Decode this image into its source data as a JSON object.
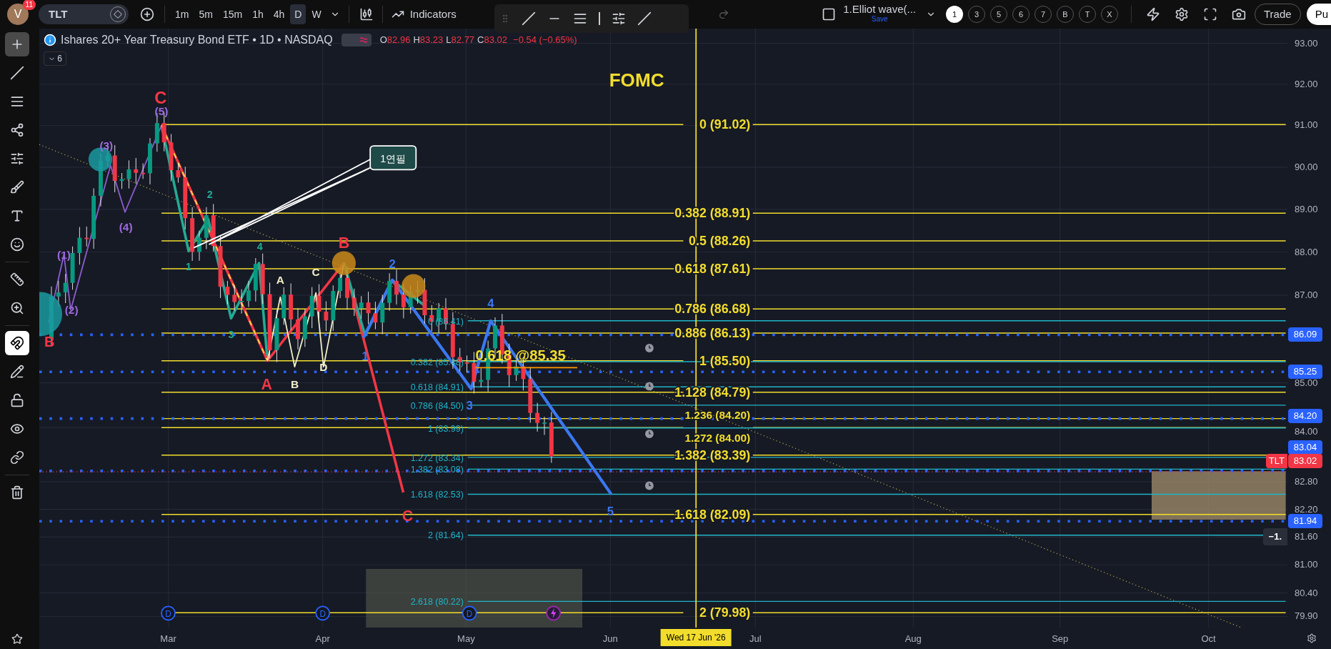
{
  "top_bar": {
    "avatar": "V",
    "badge": "11",
    "symbol": "TLT",
    "intervals": [
      {
        "label": "1m",
        "selected": false
      },
      {
        "label": "5m",
        "selected": false
      },
      {
        "label": "15m",
        "selected": false
      },
      {
        "label": "1h",
        "selected": false
      },
      {
        "label": "4h",
        "selected": false
      },
      {
        "label": "D",
        "selected": true
      },
      {
        "label": "W",
        "selected": false
      }
    ],
    "indicators": "Indicators",
    "layout": {
      "name": "1.Elliot wave(...",
      "save": "Save"
    },
    "hotkeys": [
      {
        "label": "1",
        "selected": true
      },
      {
        "label": "3",
        "selected": false
      },
      {
        "label": "5",
        "selected": false
      },
      {
        "label": "6",
        "selected": false
      },
      {
        "label": "7",
        "selected": false
      },
      {
        "label": "B",
        "selected": false
      },
      {
        "label": "T",
        "selected": false
      },
      {
        "label": "X",
        "selected": false
      }
    ],
    "trade": "Trade",
    "publish": "Pu"
  },
  "left_toolbar": [
    {
      "kind": "crosshair",
      "selected": true,
      "active": false
    },
    {
      "kind": "trendline",
      "selected": false,
      "active": false
    },
    {
      "kind": "fib",
      "selected": false,
      "active": false
    },
    {
      "kind": "pattern",
      "selected": false,
      "active": false
    },
    {
      "kind": "forecast",
      "selected": false,
      "active": false
    },
    {
      "kind": "brush",
      "selected": false,
      "active": false
    },
    {
      "kind": "text",
      "selected": false,
      "active": false
    },
    {
      "kind": "emoji",
      "selected": false,
      "active": false
    },
    {
      "kind": "ruler",
      "selected": false,
      "active": false
    },
    {
      "kind": "zoom",
      "selected": false,
      "active": false
    },
    {
      "kind": "magnet",
      "selected": false,
      "active": true
    },
    {
      "kind": "lockdraw",
      "selected": false,
      "active": false
    },
    {
      "kind": "lock",
      "selected": false,
      "active": false
    },
    {
      "kind": "eye",
      "selected": false,
      "active": false
    },
    {
      "kind": "link",
      "selected": false,
      "active": false
    },
    {
      "kind": "trash",
      "selected": false,
      "active": false
    }
  ],
  "legend": {
    "title": "Ishares 20+ Year Treasury Bond ETF • 1D • NASDAQ",
    "ohlc": [
      {
        "key": "O",
        "value": "82.96"
      },
      {
        "key": "H",
        "value": "83.23"
      },
      {
        "key": "L",
        "value": "82.77"
      },
      {
        "key": "C",
        "value": "83.02"
      }
    ],
    "change": "−0.54 (−0.65%)",
    "collapse": "6"
  },
  "chart": {
    "event_title": "FOMC",
    "target_label": "0.618 @85.35",
    "callout": "1연필",
    "wave_labels": [
      {
        "text": "C",
        "color": "#f23645"
      },
      {
        "text": "(5)",
        "color": "#9c6ade"
      },
      {
        "text": "(3)",
        "color": "#9c6ade"
      },
      {
        "text": "(4)",
        "color": "#9c6ade"
      },
      {
        "text": "(1)",
        "color": "#9c6ade"
      },
      {
        "text": "(2)",
        "color": "#9c6ade"
      },
      {
        "text": "B",
        "color": "#f23645"
      },
      {
        "text": "1",
        "color": "#22ab94"
      },
      {
        "text": "2",
        "color": "#22ab94"
      },
      {
        "text": "3",
        "color": "#22ab94"
      },
      {
        "text": "4",
        "color": "#22ab94"
      },
      {
        "text": "A",
        "color": "#f3f0c8"
      },
      {
        "text": "C",
        "color": "#f3f0c8"
      },
      {
        "text": "B",
        "color": "#f3f0c8"
      },
      {
        "text": "D",
        "color": "#f3f0c8"
      },
      {
        "text": "A",
        "color": "#f23645"
      },
      {
        "text": "B",
        "color": "#f23645"
      },
      {
        "text": "1",
        "color": "#3b78f0"
      },
      {
        "text": "2",
        "color": "#3b78f0"
      },
      {
        "text": "3",
        "color": "#3b78f0"
      },
      {
        "text": "4",
        "color": "#3b78f0"
      },
      {
        "text": "5",
        "color": "#3b78f0"
      },
      {
        "text": "C",
        "color": "#f23645"
      }
    ],
    "fib_right": [
      "0 (91.02)",
      "0.382 (88.91)",
      "0.5 (88.26)",
      "0.618 (87.61)",
      "0.786 (86.68)",
      "0.886 (86.13)",
      "1 (85.50)",
      "1.128 (84.79)",
      "1.236 (84.20)",
      "1.272 (84.00)",
      "1.382 (83.39)",
      "1.618 (82.09)",
      "2 (79.98)"
    ],
    "fib_left": [
      "0 (86.41)",
      "0.382 (85.48)",
      "0.618 (84.91)",
      "0.786 (84.50)",
      "1 (83.99)",
      "1.272 (83.34)",
      "1.382 (83.08)",
      "1.618 (82.53)",
      "2 (81.64)",
      "2.618 (80.22)"
    ],
    "events": [
      {
        "kind": "dividend",
        "label": "D"
      },
      {
        "kind": "dividend",
        "label": "D"
      },
      {
        "kind": "dividend",
        "label": "D"
      },
      {
        "kind": "earnings"
      }
    ],
    "tooltip": "−1."
  },
  "price_axis": {
    "labels": [
      "93.00",
      "92.00",
      "91.00",
      "90.00",
      "89.00",
      "88.00",
      "87.00",
      "85.00",
      "84.00",
      "82.80",
      "82.20",
      "81.60",
      "81.00",
      "80.40",
      "79.90"
    ],
    "badges": [
      {
        "text": "86.09",
        "color": "#2962ff"
      },
      {
        "text": "85.25",
        "color": "#2962ff"
      },
      {
        "text": "84.20",
        "color": "#2962ff"
      },
      {
        "text": "83.04",
        "color": "#2962ff"
      },
      {
        "text": "81.94",
        "color": "#2962ff"
      }
    ],
    "last_price": {
      "symbol": "TLT",
      "value": "83.02"
    }
  },
  "time_axis": {
    "months": [
      "Mar",
      "Apr",
      "May",
      "Jun",
      "Jul",
      "Aug",
      "Sep",
      "Oct"
    ],
    "crosshair": "Wed 17 Jun '26"
  }
}
